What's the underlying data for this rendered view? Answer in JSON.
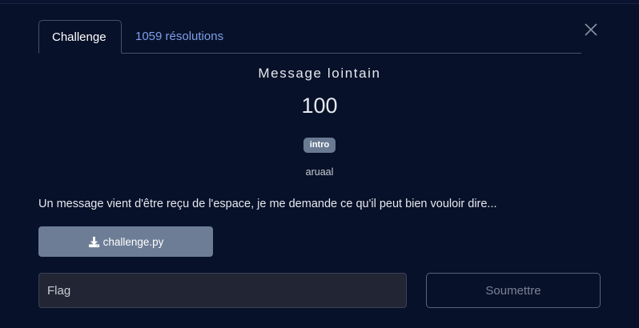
{
  "tabs": {
    "challenge_label": "Challenge",
    "solves_label": "1059 résolutions"
  },
  "challenge": {
    "title": "Message lointain",
    "points": "100",
    "tag": "intro",
    "author": "aruaal",
    "description": "Un message vient d'être reçu de l'espace, je me demande ce qu'il peut bien vouloir dire...",
    "file_name": "challenge.py"
  },
  "form": {
    "flag_placeholder": "Flag",
    "submit_label": "Soumettre"
  },
  "icons": {
    "close": "close-icon",
    "download": "download-icon"
  },
  "colors": {
    "background": "#071129",
    "link_tab": "#7f9fe8",
    "tag_bg": "#6a7a92",
    "download_btn": "#6d7d96"
  }
}
